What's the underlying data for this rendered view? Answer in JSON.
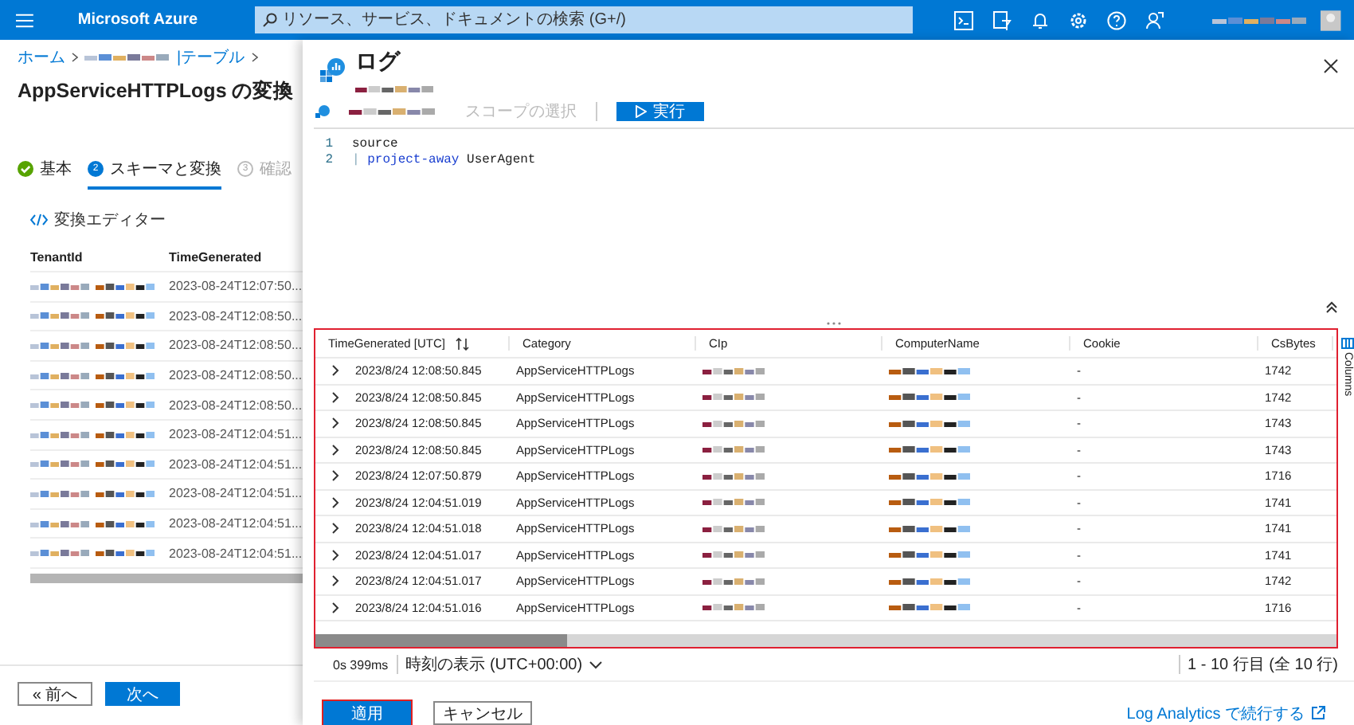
{
  "topbar": {
    "brand": "Microsoft Azure",
    "search": {
      "placeholder": "リソース、サービス、ドキュメントの検索 (G+/)"
    }
  },
  "page": {
    "breadcrumb": [
      "ホーム",
      "|テーブル"
    ],
    "title": "AppServiceHTTPLogs の変換",
    "steps": [
      {
        "kind": "done",
        "label": "基本",
        "selected": false
      },
      {
        "kind": "current",
        "number": "2",
        "label": "スキーマと変換",
        "selected": true
      },
      {
        "kind": "pending",
        "number": "3",
        "label": "確認",
        "selected": false
      }
    ],
    "editor_link": "変換エディター",
    "table": {
      "columns": [
        "TenantId",
        "TimeGenerated"
      ],
      "rows": [
        "2023-08-24T12:07:50...",
        "2023-08-24T12:08:50...",
        "2023-08-24T12:08:50...",
        "2023-08-24T12:08:50...",
        "2023-08-24T12:08:50...",
        "2023-08-24T12:04:51...",
        "2023-08-24T12:04:51...",
        "2023-08-24T12:04:51...",
        "2023-08-24T12:04:51...",
        "2023-08-24T12:04:51..."
      ]
    },
    "buttons": [
      {
        "label": "« 前へ",
        "primary": false
      },
      {
        "label": "次へ",
        "primary": true
      }
    ]
  },
  "panel": {
    "title": "ログ",
    "scope": "スコープの選択",
    "run": "実行",
    "code": [
      {
        "number": "1",
        "tokens": [
          {
            "kind": "plain",
            "text": "source"
          }
        ]
      },
      {
        "number": "2",
        "tokens": [
          {
            "kind": "pipe",
            "text": "| "
          },
          {
            "kind": "keyword",
            "text": "project-away"
          },
          {
            "kind": "plain",
            "text": " UserAgent"
          }
        ]
      }
    ],
    "results": {
      "columns": [
        "TimeGenerated [UTC]",
        "Category",
        "CIp",
        "ComputerName",
        "Cookie",
        "CsBytes"
      ],
      "rows": [
        [
          "2023/8/24 12:08:50.845",
          "AppServiceHTTPLogs",
          "-",
          "1742"
        ],
        [
          "2023/8/24 12:08:50.845",
          "AppServiceHTTPLogs",
          "-",
          "1742"
        ],
        [
          "2023/8/24 12:08:50.845",
          "AppServiceHTTPLogs",
          "-",
          "1743"
        ],
        [
          "2023/8/24 12:08:50.845",
          "AppServiceHTTPLogs",
          "-",
          "1743"
        ],
        [
          "2023/8/24 12:07:50.879",
          "AppServiceHTTPLogs",
          "-",
          "1716"
        ],
        [
          "2023/8/24 12:04:51.019",
          "AppServiceHTTPLogs",
          "-",
          "1741"
        ],
        [
          "2023/8/24 12:04:51.018",
          "AppServiceHTTPLogs",
          "-",
          "1741"
        ],
        [
          "2023/8/24 12:04:51.017",
          "AppServiceHTTPLogs",
          "-",
          "1741"
        ],
        [
          "2023/8/24 12:04:51.017",
          "AppServiceHTTPLogs",
          "-",
          "1742"
        ],
        [
          "2023/8/24 12:04:51.016",
          "AppServiceHTTPLogs",
          "-",
          "1716"
        ]
      ],
      "side_tab": "Columns"
    },
    "status": {
      "duration": "0s 399ms",
      "time_display": "時刻の表示 (UTC+00:00)",
      "count": "1 - 10 行目 (全 10 行)"
    },
    "buttons": [
      {
        "label": "適用",
        "primary": true
      },
      {
        "label": "キャンセル",
        "primary": false
      }
    ],
    "link": "Log Analytics で続行する"
  }
}
